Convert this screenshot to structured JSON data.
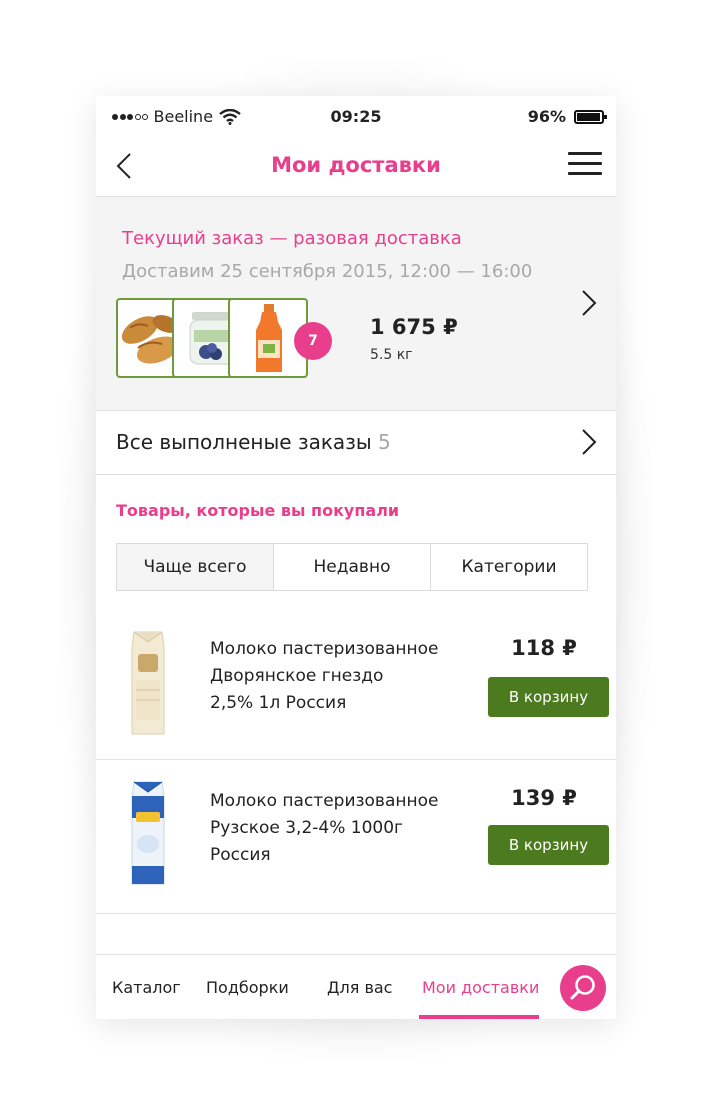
{
  "status_bar": {
    "carrier": "Beeline",
    "time": "09:25",
    "battery": "96%",
    "battery_level": 0.96
  },
  "nav": {
    "title": "Мои доставки"
  },
  "current_order": {
    "title": "Текущий заказ — разовая доставка",
    "delivery": "Доставим 25 сентября 2015, 12:00 — 16:00",
    "items_count": "7",
    "price": "1 675 ₽",
    "weight": "5.5 кг"
  },
  "all_orders": {
    "label": "Все выполненые заказы",
    "count": "5"
  },
  "purchased": {
    "title": "Товары, которые вы покупали",
    "tabs": [
      "Чаще всего",
      "Недавно",
      "Категории"
    ],
    "active_tab": 0,
    "products": [
      {
        "name_lines": [
          "Молоко пастеризованное",
          "Дворянское гнездо",
          "2,5% 1л Россия"
        ],
        "price": "118 ₽",
        "button": "В корзину"
      },
      {
        "name_lines": [
          "Молоко пастеризованное",
          "Рузское 3,2-4% 1000г",
          "Россия"
        ],
        "price": "139 ₽",
        "button": "В корзину"
      }
    ]
  },
  "tabbar": {
    "items": [
      "Каталог",
      "Подборки",
      "Для вас",
      "Мои доставки"
    ],
    "active": 3
  },
  "colors": {
    "accent": "#e83e8c",
    "button_green": "#4c7a1f",
    "thumb_border": "#6e9a3b"
  }
}
